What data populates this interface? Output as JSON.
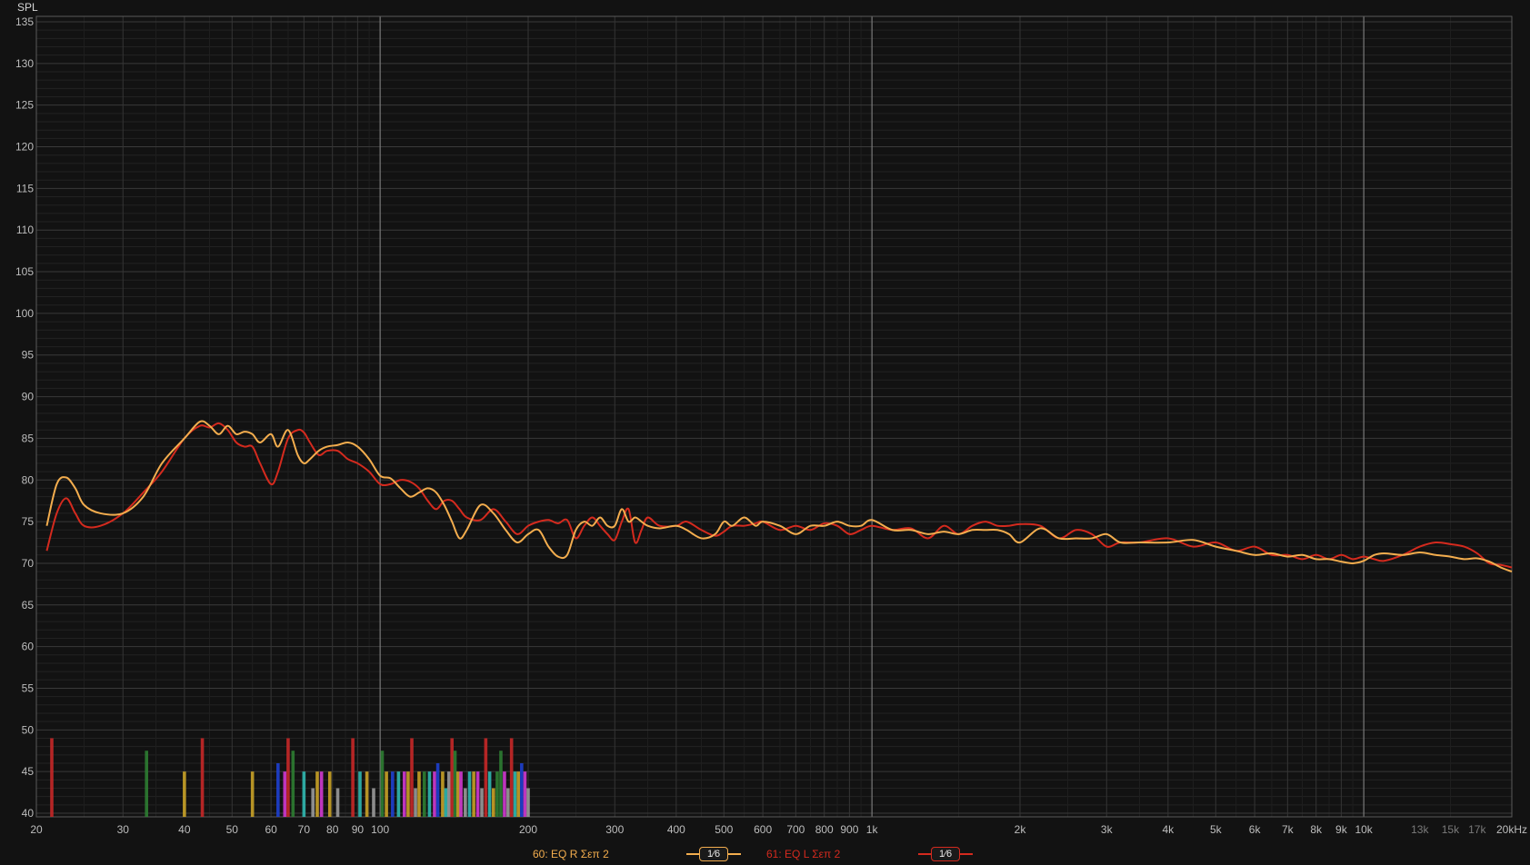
{
  "chart_data": {
    "type": "line",
    "ylabel": "SPL",
    "xlabel": "",
    "x_scale": "log",
    "xlim": [
      20,
      20000
    ],
    "ylim": [
      40,
      135
    ],
    "y_ticks": [
      "40",
      "45",
      "50",
      "55",
      "60",
      "65",
      "70",
      "75",
      "80",
      "85",
      "90",
      "95",
      "100",
      "105",
      "110",
      "115",
      "120",
      "125",
      "130",
      "135"
    ],
    "x_ticks": [
      {
        "v": 20,
        "t": "20"
      },
      {
        "v": 30,
        "t": "30"
      },
      {
        "v": 40,
        "t": "40"
      },
      {
        "v": 50,
        "t": "50"
      },
      {
        "v": 60,
        "t": "60"
      },
      {
        "v": 70,
        "t": "70"
      },
      {
        "v": 80,
        "t": "80"
      },
      {
        "v": 90,
        "t": "90"
      },
      {
        "v": 100,
        "t": "100"
      },
      {
        "v": 200,
        "t": "200"
      },
      {
        "v": 300,
        "t": "300"
      },
      {
        "v": 400,
        "t": "400"
      },
      {
        "v": 500,
        "t": "500"
      },
      {
        "v": 600,
        "t": "600"
      },
      {
        "v": 700,
        "t": "700"
      },
      {
        "v": 800,
        "t": "800"
      },
      {
        "v": 900,
        "t": "900"
      },
      {
        "v": 1000,
        "t": "1k"
      },
      {
        "v": 2000,
        "t": "2k"
      },
      {
        "v": 3000,
        "t": "3k"
      },
      {
        "v": 4000,
        "t": "4k"
      },
      {
        "v": 5000,
        "t": "5k"
      },
      {
        "v": 6000,
        "t": "6k"
      },
      {
        "v": 7000,
        "t": "7k"
      },
      {
        "v": 8000,
        "t": "8k"
      },
      {
        "v": 9000,
        "t": "9k"
      },
      {
        "v": 10000,
        "t": "10k"
      },
      {
        "v": 13000,
        "t": "13k",
        "dim": true
      },
      {
        "v": 15000,
        "t": "15k",
        "dim": true
      },
      {
        "v": 17000,
        "t": "17k",
        "dim": true
      },
      {
        "v": 20000,
        "t": "20kHz"
      }
    ],
    "grid": true,
    "legend_position": "bottom",
    "series": [
      {
        "name": "61: EQ L Σεπ 2",
        "color": "#d42a1e",
        "x": [
          21,
          22,
          23,
          24,
          25,
          27,
          30,
          33,
          36,
          40,
          43,
          45,
          47,
          49,
          51,
          53,
          55,
          57,
          60,
          62,
          65,
          68,
          70,
          72,
          75,
          78,
          82,
          86,
          90,
          95,
          100,
          105,
          110,
          115,
          120,
          125,
          130,
          135,
          140,
          145,
          150,
          160,
          170,
          180,
          190,
          200,
          210,
          220,
          230,
          240,
          250,
          260,
          270,
          280,
          290,
          300,
          310,
          320,
          330,
          340,
          350,
          370,
          400,
          420,
          450,
          480,
          500,
          520,
          550,
          580,
          600,
          650,
          700,
          750,
          800,
          850,
          900,
          950,
          1000,
          1100,
          1200,
          1300,
          1400,
          1500,
          1600,
          1700,
          1800,
          1900,
          2000,
          2200,
          2400,
          2600,
          2800,
          3000,
          3200,
          3500,
          4000,
          4500,
          5000,
          5500,
          6000,
          6500,
          7000,
          7500,
          8000,
          8500,
          9000,
          9500,
          10000,
          10500,
          11000,
          12000,
          13000,
          14000,
          15000,
          16000,
          17000,
          18000,
          19000,
          20000
        ],
        "y": [
          71.5,
          76,
          77.8,
          76,
          74.5,
          74.5,
          76,
          78.5,
          81,
          85,
          86.5,
          86.3,
          86.8,
          86,
          84.5,
          84,
          84,
          82,
          79.5,
          81,
          85,
          86,
          85.7,
          84.5,
          83,
          83.5,
          83.5,
          82.5,
          82,
          81,
          79.5,
          79.5,
          80,
          79.8,
          79,
          77.5,
          76.5,
          77.5,
          77.5,
          76.5,
          75.5,
          75.2,
          76.5,
          75,
          73.5,
          74.5,
          75,
          75.2,
          74.8,
          75.2,
          73,
          74.5,
          75.5,
          74.5,
          73.5,
          72.8,
          75,
          76.5,
          72.5,
          74,
          75.5,
          74.5,
          74.5,
          75,
          74,
          73.3,
          73.8,
          74.5,
          74.5,
          74.8,
          75,
          74,
          74.5,
          74,
          74.8,
          74.5,
          73.5,
          74,
          74.5,
          74,
          74.2,
          73,
          74.5,
          73.5,
          74.5,
          75,
          74.5,
          74.5,
          74.7,
          74.5,
          73,
          74,
          73.5,
          72,
          72.5,
          72.5,
          73,
          72,
          72.5,
          71.5,
          72,
          71,
          71,
          70.5,
          71,
          70.5,
          71,
          70.5,
          70.8,
          70.5,
          70.3,
          71,
          72,
          72.5,
          72.3,
          72,
          71.2,
          70,
          69.8,
          69.5
        ]
      },
      {
        "name": "60: EQ R Σεπ 2",
        "color": "#f3ad4e",
        "x": [
          21,
          22,
          23,
          24,
          25,
          27,
          30,
          33,
          36,
          40,
          43,
          45,
          47,
          49,
          51,
          53,
          55,
          57,
          60,
          62,
          65,
          68,
          70,
          72,
          75,
          78,
          82,
          86,
          90,
          95,
          100,
          105,
          110,
          115,
          120,
          125,
          130,
          135,
          140,
          145,
          150,
          160,
          170,
          180,
          190,
          200,
          210,
          220,
          230,
          240,
          250,
          260,
          270,
          280,
          290,
          300,
          310,
          320,
          330,
          340,
          350,
          370,
          400,
          420,
          450,
          480,
          500,
          520,
          550,
          580,
          600,
          650,
          700,
          750,
          800,
          850,
          900,
          950,
          1000,
          1100,
          1200,
          1300,
          1400,
          1500,
          1600,
          1700,
          1800,
          1900,
          2000,
          2200,
          2400,
          2600,
          2800,
          3000,
          3200,
          3500,
          4000,
          4500,
          5000,
          5500,
          6000,
          6500,
          7000,
          7500,
          8000,
          8500,
          9000,
          9500,
          10000,
          10500,
          11000,
          12000,
          13000,
          14000,
          15000,
          16000,
          17000,
          18000,
          19000,
          20000
        ],
        "y": [
          74.5,
          79.5,
          80.3,
          79,
          77,
          76,
          76,
          78,
          82,
          85,
          87,
          86.5,
          85.5,
          86.5,
          85.5,
          85.8,
          85.5,
          84.5,
          85.5,
          84,
          86,
          83,
          82,
          82.5,
          83.5,
          84,
          84.2,
          84.5,
          84,
          82.5,
          80.5,
          80.2,
          79,
          78,
          78.5,
          79,
          78.5,
          77,
          75,
          73,
          74,
          77,
          76,
          74,
          72.5,
          73.5,
          74,
          72,
          70.8,
          71,
          74,
          75,
          74.5,
          75.5,
          74.5,
          74.5,
          76.5,
          75,
          75.5,
          75,
          74.5,
          74.2,
          74.5,
          74,
          73,
          73.5,
          75,
          74.5,
          75.5,
          74.5,
          75,
          74.5,
          73.5,
          74.5,
          74.5,
          75,
          74.5,
          74.5,
          75.2,
          74,
          74,
          73.5,
          73.8,
          73.5,
          74,
          74,
          74,
          73.5,
          72.5,
          74.2,
          73,
          73,
          73,
          73.5,
          72.5,
          72.5,
          72.5,
          72.8,
          72,
          71.5,
          71,
          71.2,
          70.8,
          71,
          70.5,
          70.5,
          70.2,
          70,
          70.3,
          71,
          71.2,
          71,
          71.3,
          71,
          70.8,
          70.5,
          70.6,
          70.2,
          69.5,
          69
        ]
      }
    ],
    "eq_filter_markers": [
      {
        "freq": 21.5,
        "top": 49,
        "color": "#c62828"
      },
      {
        "freq": 33.5,
        "top": 47.5,
        "color": "#2e7d32"
      },
      {
        "freq": 40,
        "top": 45,
        "color": "#c9a227"
      },
      {
        "freq": 43.5,
        "top": 49,
        "color": "#c62828"
      },
      {
        "freq": 55,
        "top": 45,
        "color": "#c9a227"
      },
      {
        "freq": 62,
        "top": 46,
        "color": "#1e40d0"
      },
      {
        "freq": 64,
        "top": 45,
        "color": "#d03ad0"
      },
      {
        "freq": 65,
        "top": 49,
        "color": "#c62828"
      },
      {
        "freq": 66.5,
        "top": 47.5,
        "color": "#2e7d32"
      },
      {
        "freq": 70,
        "top": 45,
        "color": "#30b8b0"
      },
      {
        "freq": 73,
        "top": 43,
        "color": "#9a9a9a"
      },
      {
        "freq": 74.5,
        "top": 45,
        "color": "#c9a227"
      },
      {
        "freq": 76,
        "top": 45,
        "color": "#d03ad0"
      },
      {
        "freq": 79,
        "top": 45,
        "color": "#c9a227"
      },
      {
        "freq": 82,
        "top": 43,
        "color": "#9a9a9a"
      },
      {
        "freq": 88,
        "top": 49,
        "color": "#c62828"
      },
      {
        "freq": 91,
        "top": 45,
        "color": "#30b8b0"
      },
      {
        "freq": 94,
        "top": 45,
        "color": "#c9a227"
      },
      {
        "freq": 97,
        "top": 43,
        "color": "#9a9a9a"
      },
      {
        "freq": 101,
        "top": 47.5,
        "color": "#2e7d32"
      },
      {
        "freq": 103,
        "top": 45,
        "color": "#c9a227"
      },
      {
        "freq": 106,
        "top": 45,
        "color": "#1e40d0"
      },
      {
        "freq": 109,
        "top": 45,
        "color": "#30b8b0"
      },
      {
        "freq": 112,
        "top": 45,
        "color": "#d03ad0"
      },
      {
        "freq": 114,
        "top": 45,
        "color": "#c9a227"
      },
      {
        "freq": 116,
        "top": 49,
        "color": "#c62828"
      },
      {
        "freq": 118,
        "top": 43,
        "color": "#9a9a9a"
      },
      {
        "freq": 120,
        "top": 45,
        "color": "#c9a227"
      },
      {
        "freq": 123,
        "top": 45,
        "color": "#2e7d32"
      },
      {
        "freq": 126,
        "top": 45,
        "color": "#30b8b0"
      },
      {
        "freq": 129,
        "top": 45,
        "color": "#d03ad0"
      },
      {
        "freq": 131,
        "top": 46,
        "color": "#1e40d0"
      },
      {
        "freq": 134,
        "top": 45,
        "color": "#c9a227"
      },
      {
        "freq": 136,
        "top": 43,
        "color": "#30b8b0"
      },
      {
        "freq": 138,
        "top": 45,
        "color": "#9a9a9a"
      },
      {
        "freq": 140,
        "top": 49,
        "color": "#c62828"
      },
      {
        "freq": 142,
        "top": 47.5,
        "color": "#2e7d32"
      },
      {
        "freq": 144,
        "top": 45,
        "color": "#c9a227"
      },
      {
        "freq": 146,
        "top": 45,
        "color": "#d03ad0"
      },
      {
        "freq": 149,
        "top": 43,
        "color": "#9a9a9a"
      },
      {
        "freq": 152,
        "top": 45,
        "color": "#30b8b0"
      },
      {
        "freq": 155,
        "top": 45,
        "color": "#c9a227"
      },
      {
        "freq": 158,
        "top": 45,
        "color": "#d03ad0"
      },
      {
        "freq": 161,
        "top": 43,
        "color": "#9a9a9a"
      },
      {
        "freq": 164,
        "top": 49,
        "color": "#c62828"
      },
      {
        "freq": 167,
        "top": 45,
        "color": "#30b8b0"
      },
      {
        "freq": 170,
        "top": 43,
        "color": "#c9a227"
      },
      {
        "freq": 173,
        "top": 45,
        "color": "#2e7d32"
      },
      {
        "freq": 176,
        "top": 47.5,
        "color": "#2e7d32"
      },
      {
        "freq": 179,
        "top": 45,
        "color": "#d03ad0"
      },
      {
        "freq": 182,
        "top": 43,
        "color": "#9a9a9a"
      },
      {
        "freq": 185,
        "top": 49,
        "color": "#c62828"
      },
      {
        "freq": 188,
        "top": 45,
        "color": "#30b8b0"
      },
      {
        "freq": 191,
        "top": 45,
        "color": "#c9a227"
      },
      {
        "freq": 194,
        "top": 46,
        "color": "#1e40d0"
      },
      {
        "freq": 197,
        "top": 45,
        "color": "#d03ad0"
      },
      {
        "freq": 200,
        "top": 43,
        "color": "#9a9a9a"
      }
    ]
  },
  "legend": {
    "item1": {
      "label": "60: EQ R Σεπ 2",
      "color": "#f3ad4e",
      "smoothing": "1⁄6"
    },
    "item2": {
      "label": "61: EQ L Σεπ 2",
      "color": "#d42a1e",
      "smoothing": "1⁄6"
    }
  }
}
